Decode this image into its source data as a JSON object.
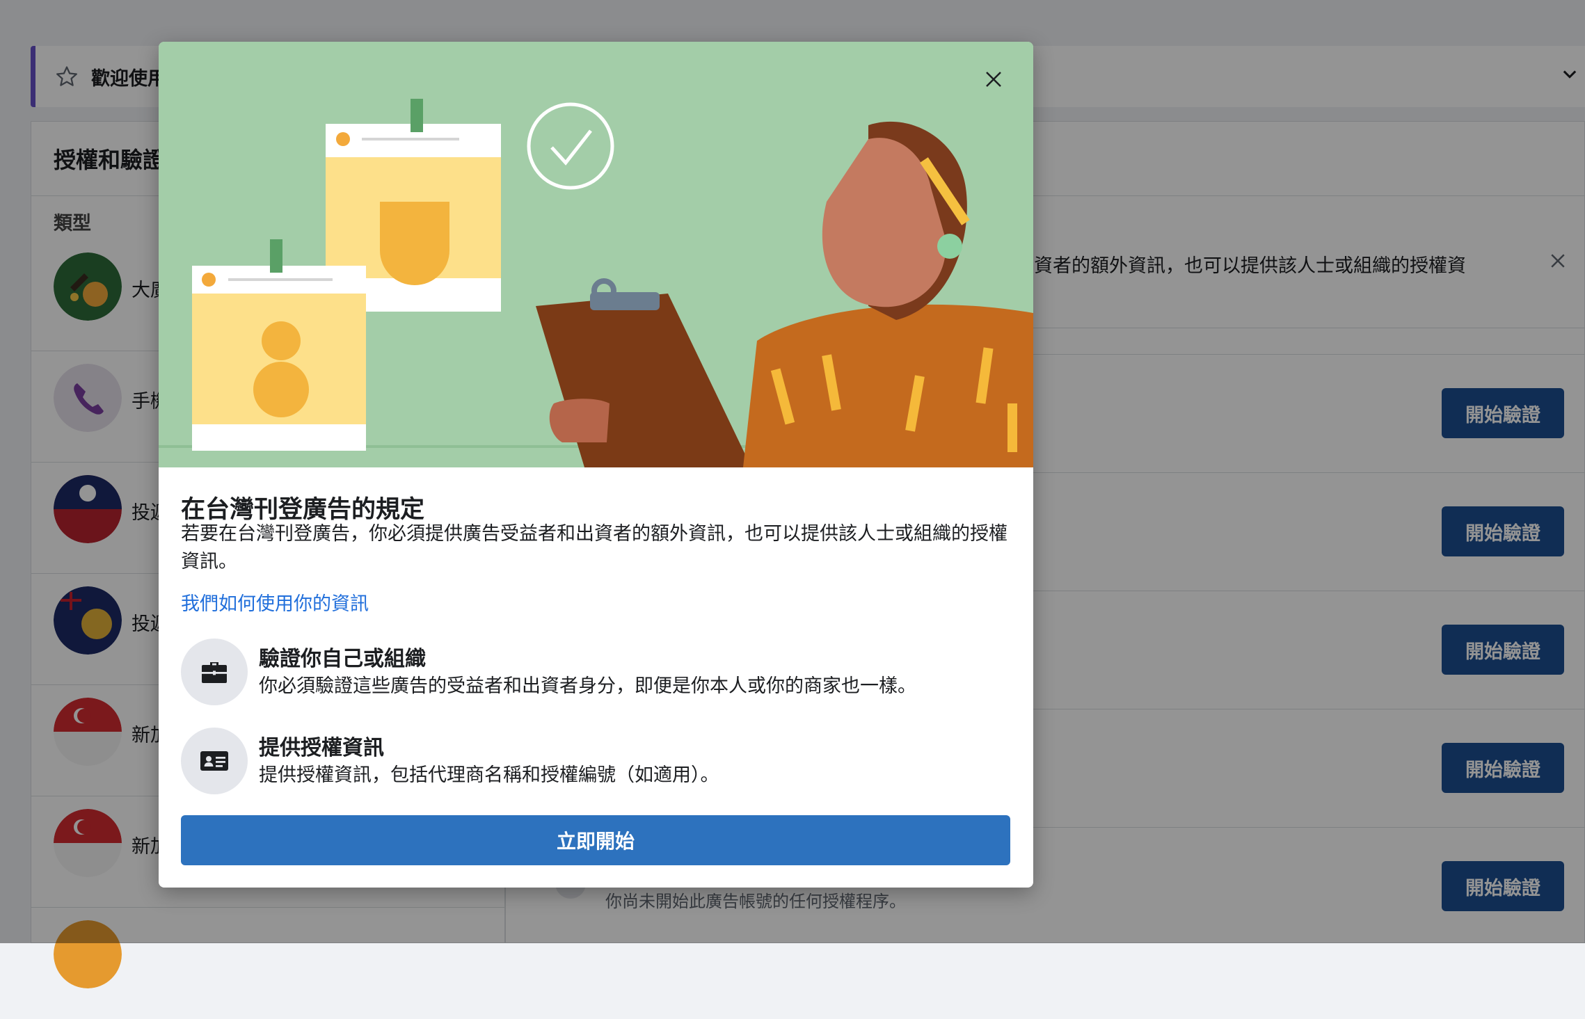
{
  "welcome": {
    "title": "歡迎使用",
    "star_icon": "star-icon",
    "chevron_icon": "chevron-down-icon"
  },
  "left_panel": {
    "heading": "授權和驗證",
    "type_label": "類型",
    "rows": [
      {
        "label": "大廣",
        "icon": "govt-bag-icon"
      },
      {
        "label": "手機",
        "icon": "phone-icon"
      },
      {
        "label": "投遞",
        "icon": "taiwan-flag-icon"
      },
      {
        "label": "投遞",
        "icon": "australia-flag-icon"
      },
      {
        "label": "新加",
        "icon": "singapore-flag-icon"
      },
      {
        "label": "新加",
        "icon": "singapore-flag-icon"
      },
      {
        "label": "",
        "icon": "orange-circle-icon"
      }
    ]
  },
  "right_panel": {
    "notice_text": "資者的額外資訊，也可以提供該人士或組織的授權資",
    "verify_buttons": [
      "開始驗證",
      "開始驗證",
      "開始驗證",
      "開始驗證",
      "開始驗證"
    ],
    "status_text": "你尚未開始此廣告帳號的任何授權程序。"
  },
  "modal": {
    "title": "在台灣刊登廣告的規定",
    "description": "若要在台灣刊登廣告，你必須提供廣告受益者和出資者的額外資訊，也可以提供該人士或組織的授權資訊。",
    "link": "我們如何使用你的資訊",
    "features": [
      {
        "icon": "briefcase-icon",
        "title": "驗證你自己或組織",
        "desc": "你必須驗證這些廣告的受益者和出資者身分，即便是你本人或你的商家也一樣。"
      },
      {
        "icon": "id-card-icon",
        "title": "提供授權資訊",
        "desc": "提供授權資訊，包括代理商名稱和授權編號（如適用）。"
      }
    ],
    "start_button": "立即開始",
    "close_icon": "close-icon"
  },
  "colors": {
    "accent": "#2d72be",
    "verify_button": "#1d4f91",
    "hero_bg": "#a3cda8",
    "link": "#216fdb",
    "purple_edge": "#6750c9"
  }
}
